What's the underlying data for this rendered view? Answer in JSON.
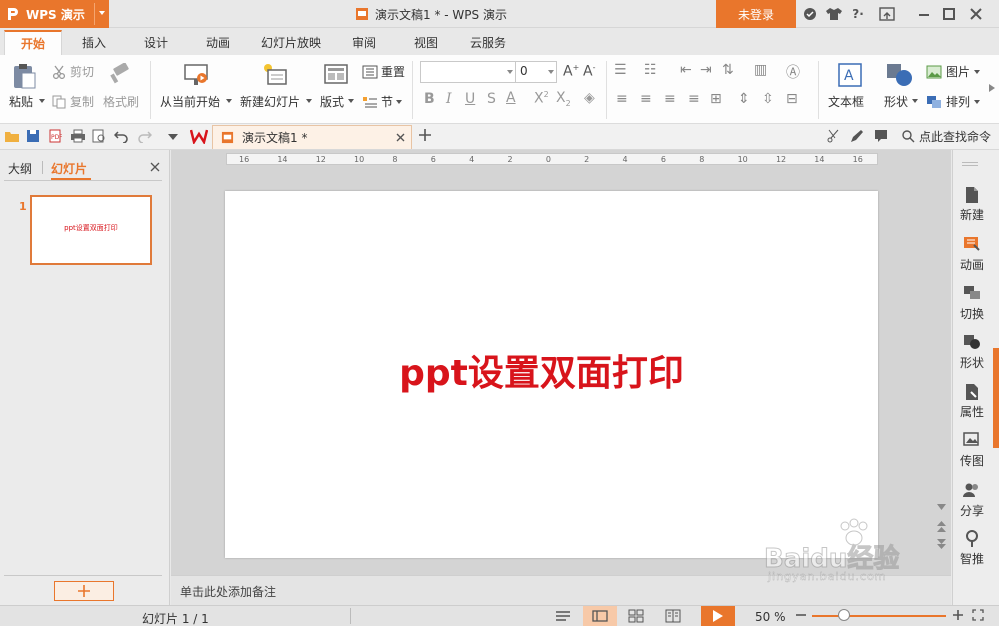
{
  "app": {
    "name": "WPS 演示",
    "doc_title": "演示文稿1 * - WPS 演示",
    "login": "未登录"
  },
  "colors": {
    "accent": "#e9762c",
    "title_red": "#d8141b"
  },
  "tabs": [
    "开始",
    "插入",
    "设计",
    "动画",
    "幻灯片放映",
    "审阅",
    "视图",
    "云服务"
  ],
  "ribbon": {
    "paste": "粘贴",
    "cut": "剪切",
    "copy": "复制",
    "format_painter": "格式刷",
    "from_current": "从当前开始",
    "new_slide": "新建幻灯片",
    "layout": "版式",
    "reset": "重置",
    "section": "节",
    "font_size": "0",
    "textbox": "文本框",
    "shape": "形状",
    "picture": "图片",
    "arrange": "排列"
  },
  "qat": {
    "doc_tab": "演示文稿1 *",
    "search": "点此查找命令"
  },
  "left_pane": {
    "outline_tab": "大纲",
    "slides_tab": "幻灯片",
    "slide_number": "1",
    "thumb_text": "ppt设置双面打印"
  },
  "ruler_labels": [
    "16",
    "14",
    "12",
    "10",
    "8",
    "6",
    "4",
    "2",
    "0",
    "2",
    "4",
    "6",
    "8",
    "10",
    "12",
    "14",
    "16"
  ],
  "slide": {
    "title": "ppt设置双面打印"
  },
  "notes_placeholder": "单击此处添加备注",
  "right_panel": [
    {
      "label": "新建",
      "icon": "new-icon"
    },
    {
      "label": "动画",
      "icon": "animation-icon"
    },
    {
      "label": "切换",
      "icon": "transition-icon"
    },
    {
      "label": "形状",
      "icon": "shape-icon"
    },
    {
      "label": "属性",
      "icon": "properties-icon"
    },
    {
      "label": "传图",
      "icon": "upload-image-icon"
    },
    {
      "label": "分享",
      "icon": "share-icon"
    },
    {
      "label": "智推",
      "icon": "smart-push-icon"
    }
  ],
  "status": {
    "slide_info": "幻灯片 1 / 1",
    "zoom": "50 %"
  },
  "watermark": {
    "brand": "Baidu经验",
    "url": "jingyan.baidu.com"
  }
}
